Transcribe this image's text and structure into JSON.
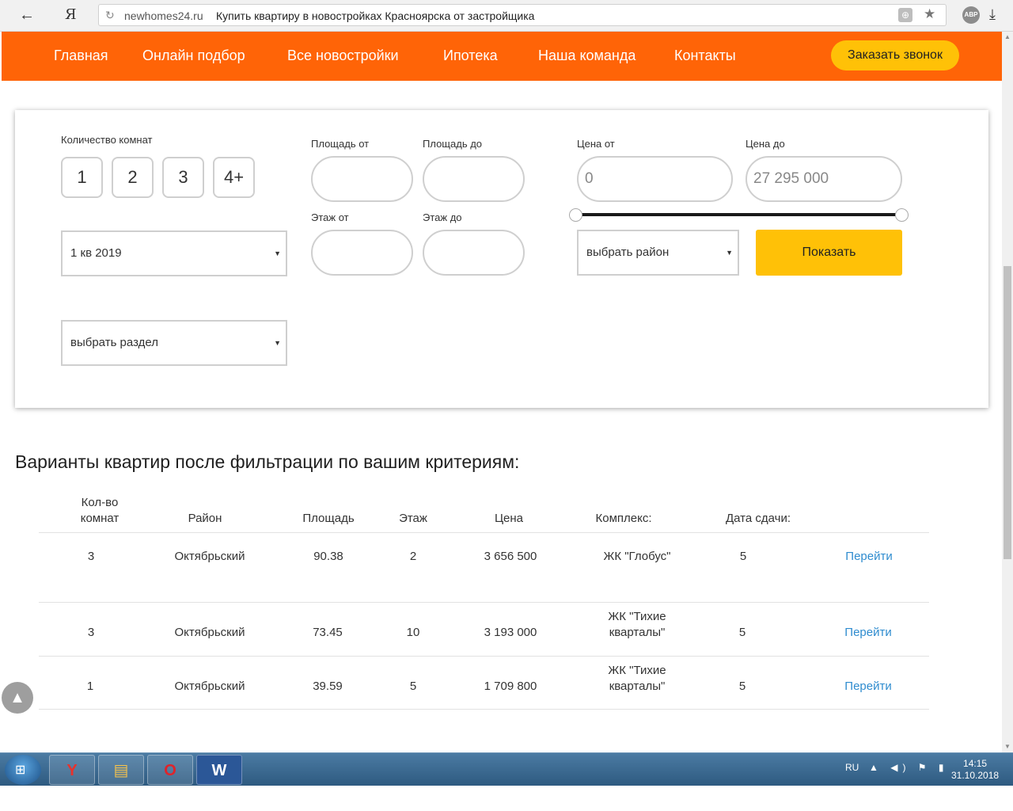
{
  "browser": {
    "back_glyph": "←",
    "logo": "Я",
    "reload_glyph": "↻",
    "url_domain": "newhomes24.ru",
    "page_title": "Купить квартиру в новостройках Красноярска от застройщика",
    "translate_glyph": "⊕",
    "star_glyph": "★",
    "adblock_label": "ABP",
    "download_glyph": "⤓"
  },
  "nav": {
    "items": [
      "Главная",
      "Онлайн подбор",
      "Все новостройки",
      "Ипотека",
      "Наша команда",
      "Контакты"
    ],
    "callback_label": "Заказать звонок"
  },
  "filter": {
    "rooms_label": "Количество комнат",
    "rooms": [
      "1",
      "2",
      "3",
      "4+"
    ],
    "area_from_label": "Площадь от",
    "area_to_label": "Площадь до",
    "floor_from_label": "Этаж от",
    "floor_to_label": "Этаж до",
    "price_from_label": "Цена от",
    "price_to_label": "Цена до",
    "price_from_value": "0",
    "price_to_value": "27 295 000",
    "price_slider": {
      "min": 0,
      "max": 27295000,
      "low": 0,
      "high": 27295000
    },
    "quarter_select": "1 кв 2019",
    "section_select": "выбрать раздел",
    "district_select": "выбрать район",
    "arrow_glyph": "▼",
    "show_label": "Показать"
  },
  "results": {
    "title": "Варианты квартир после фильтрации по вашим критериям:",
    "headers": {
      "rooms_line1": "Кол-во",
      "rooms_line2": "комнат",
      "district": "Район",
      "area": "Площадь",
      "floor": "Этаж",
      "price": "Цена",
      "complex": "Комплекс:",
      "date": "Дата сдачи:"
    },
    "rows": [
      {
        "rooms": "3",
        "district": "Октябрьский",
        "area": "90.38",
        "floor": "2",
        "price": "3 656 500",
        "complex_line1": "ЖК \"Глобус\"",
        "complex_line2": "",
        "date": "5",
        "link": "Перейти"
      },
      {
        "rooms": "3",
        "district": "Октябрьский",
        "area": "73.45",
        "floor": "10",
        "price": "3 193 000",
        "complex_line1": "ЖК \"Тихие",
        "complex_line2": "кварталы\"",
        "date": "5",
        "link": "Перейти"
      },
      {
        "rooms": "1",
        "district": "Октябрьский",
        "area": "39.59",
        "floor": "5",
        "price": "1 709 800",
        "complex_line1": "ЖК \"Тихие",
        "complex_line2": "кварталы\"",
        "date": "5",
        "link": "Перейти"
      }
    ]
  },
  "scroll_top_glyph": "▲",
  "taskbar": {
    "start_glyph": "⊞",
    "apps": [
      {
        "name": "yandex-browser",
        "glyph": "Y",
        "color": "#e8322c"
      },
      {
        "name": "file-explorer",
        "glyph": "▤",
        "color": "#f2c14e"
      },
      {
        "name": "opera",
        "glyph": "O",
        "color": "#e0242a"
      },
      {
        "name": "word",
        "glyph": "W",
        "color": "#2b5797"
      }
    ],
    "lang": "RU",
    "tray_icons": "▲ ◀) ⚑ ▮",
    "time": "14:15",
    "date": "31.10.2018"
  }
}
